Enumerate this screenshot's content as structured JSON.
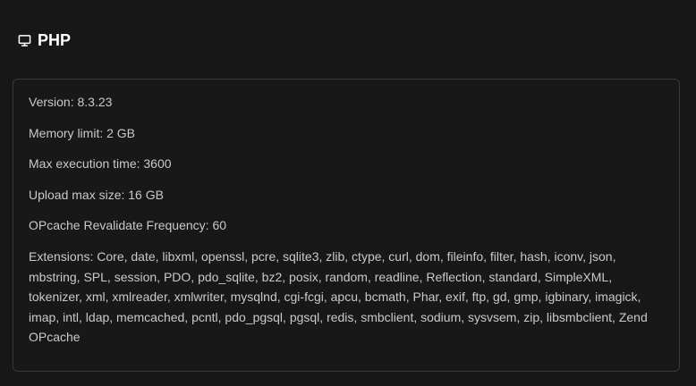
{
  "header": {
    "icon": "monitor-icon",
    "title": "PHP"
  },
  "info": {
    "version": "Version: 8.3.23",
    "memory_limit": "Memory limit: 2 GB",
    "max_execution_time": "Max execution time: 3600",
    "upload_max_size": "Upload max size: 16 GB",
    "opcache_revalidate_frequency": "OPcache Revalidate Frequency: 60",
    "extensions": "Extensions: Core, date, libxml, openssl, pcre, sqlite3, zlib, ctype, curl, dom, fileinfo, filter, hash, iconv, json, mbstring, SPL, session, PDO, pdo_sqlite, bz2, posix, random, readline, Reflection, standard, SimpleXML, tokenizer, xml, xmlreader, xmlwriter, mysqlnd, cgi-fcgi, apcu, bcmath, Phar, exif, ftp, gd, gmp, igbinary, imagick, imap, intl, ldap, memcached, pcntl, pdo_pgsql, pgsql, redis, smbclient, sodium, sysvsem, zip, libsmbclient, Zend OPcache"
  },
  "colors": {
    "background": "#171717",
    "card_border": "#3a3a3a",
    "title": "#ffffff",
    "text": "#c9c9c9"
  }
}
